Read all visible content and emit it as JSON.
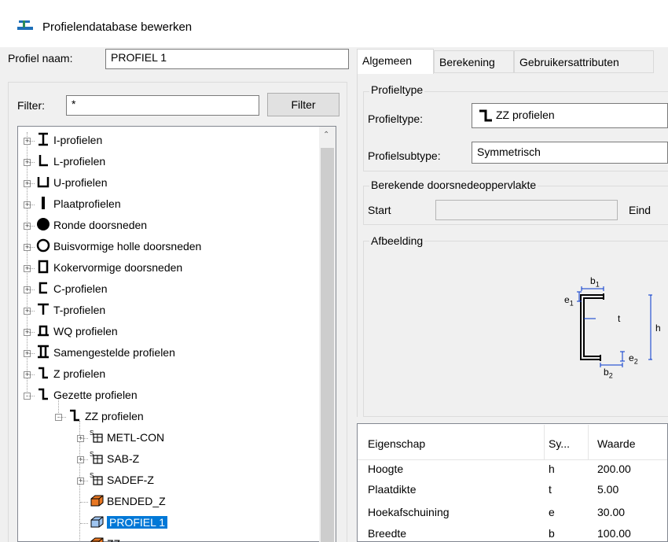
{
  "window": {
    "title": "Profielendatabase bewerken"
  },
  "profile": {
    "name_label": "Profiel naam:",
    "name_value": "PROFIEL 1"
  },
  "filter": {
    "label": "Filter:",
    "value": "*",
    "button": "Filter"
  },
  "tree": {
    "items": [
      {
        "label": "I-profielen",
        "icon": "i-profile-icon"
      },
      {
        "label": "L-profielen",
        "icon": "l-profile-icon"
      },
      {
        "label": "U-profielen",
        "icon": "u-profile-icon"
      },
      {
        "label": "Plaatprofielen",
        "icon": "plate-icon"
      },
      {
        "label": "Ronde doorsneden",
        "icon": "round-icon"
      },
      {
        "label": "Buisvormige holle doorsneden",
        "icon": "tube-icon"
      },
      {
        "label": "Kokervormige doorsneden",
        "icon": "box-icon"
      },
      {
        "label": "C-profielen",
        "icon": "c-profile-icon"
      },
      {
        "label": "T-profielen",
        "icon": "t-profile-icon"
      },
      {
        "label": "WQ profielen",
        "icon": "wq-profile-icon"
      },
      {
        "label": "Samengestelde profielen",
        "icon": "composite-icon"
      },
      {
        "label": "Z profielen",
        "icon": "z-profile-icon"
      },
      {
        "label": "Gezette profielen",
        "icon": "z-profile-icon"
      },
      {
        "label": "ZZ profielen",
        "icon": "z-profile-icon"
      },
      {
        "label": "METL-CON",
        "icon": "catalog-icon"
      },
      {
        "label": "SAB-Z",
        "icon": "catalog-icon"
      },
      {
        "label": "SADEF-Z",
        "icon": "catalog-icon"
      },
      {
        "label": "BENDED_Z",
        "icon": "orange-profile-icon"
      },
      {
        "label": "PROFIEL 1",
        "icon": "blue-profile-icon"
      },
      {
        "label": "ZZ",
        "icon": "orange-profile-icon"
      }
    ]
  },
  "tabs": [
    {
      "label": "Algemeen",
      "active": true
    },
    {
      "label": "Berekening",
      "active": false
    },
    {
      "label": "Gebruikersattributen",
      "active": false
    }
  ],
  "profiletype": {
    "group": "Profieltype",
    "type_label": "Profieltype:",
    "type_value": "ZZ profielen",
    "subtype_label": "Profielsubtype:",
    "subtype_value": "Symmetrisch"
  },
  "area": {
    "group": "Berekende doorsnedeoppervlakte",
    "start": "Start",
    "end": "Eind"
  },
  "image": {
    "group": "Afbeelding",
    "labels": {
      "b1": "b",
      "b1_sub": "1",
      "e1": "e",
      "e1_sub": "1",
      "t": "t",
      "h": "h",
      "e2": "e",
      "e2_sub": "2",
      "b2": "b",
      "b2_sub": "2"
    }
  },
  "properties": {
    "headers": [
      "Eigenschap",
      "Sy...",
      "Waarde"
    ],
    "rows": [
      [
        "Hoogte",
        "h",
        "200.00"
      ],
      [
        "Plaatdikte",
        "t",
        "5.00"
      ],
      [
        "Hoekafschuining",
        "e",
        "30.00"
      ],
      [
        "Breedte",
        "b",
        "100.00"
      ]
    ]
  }
}
